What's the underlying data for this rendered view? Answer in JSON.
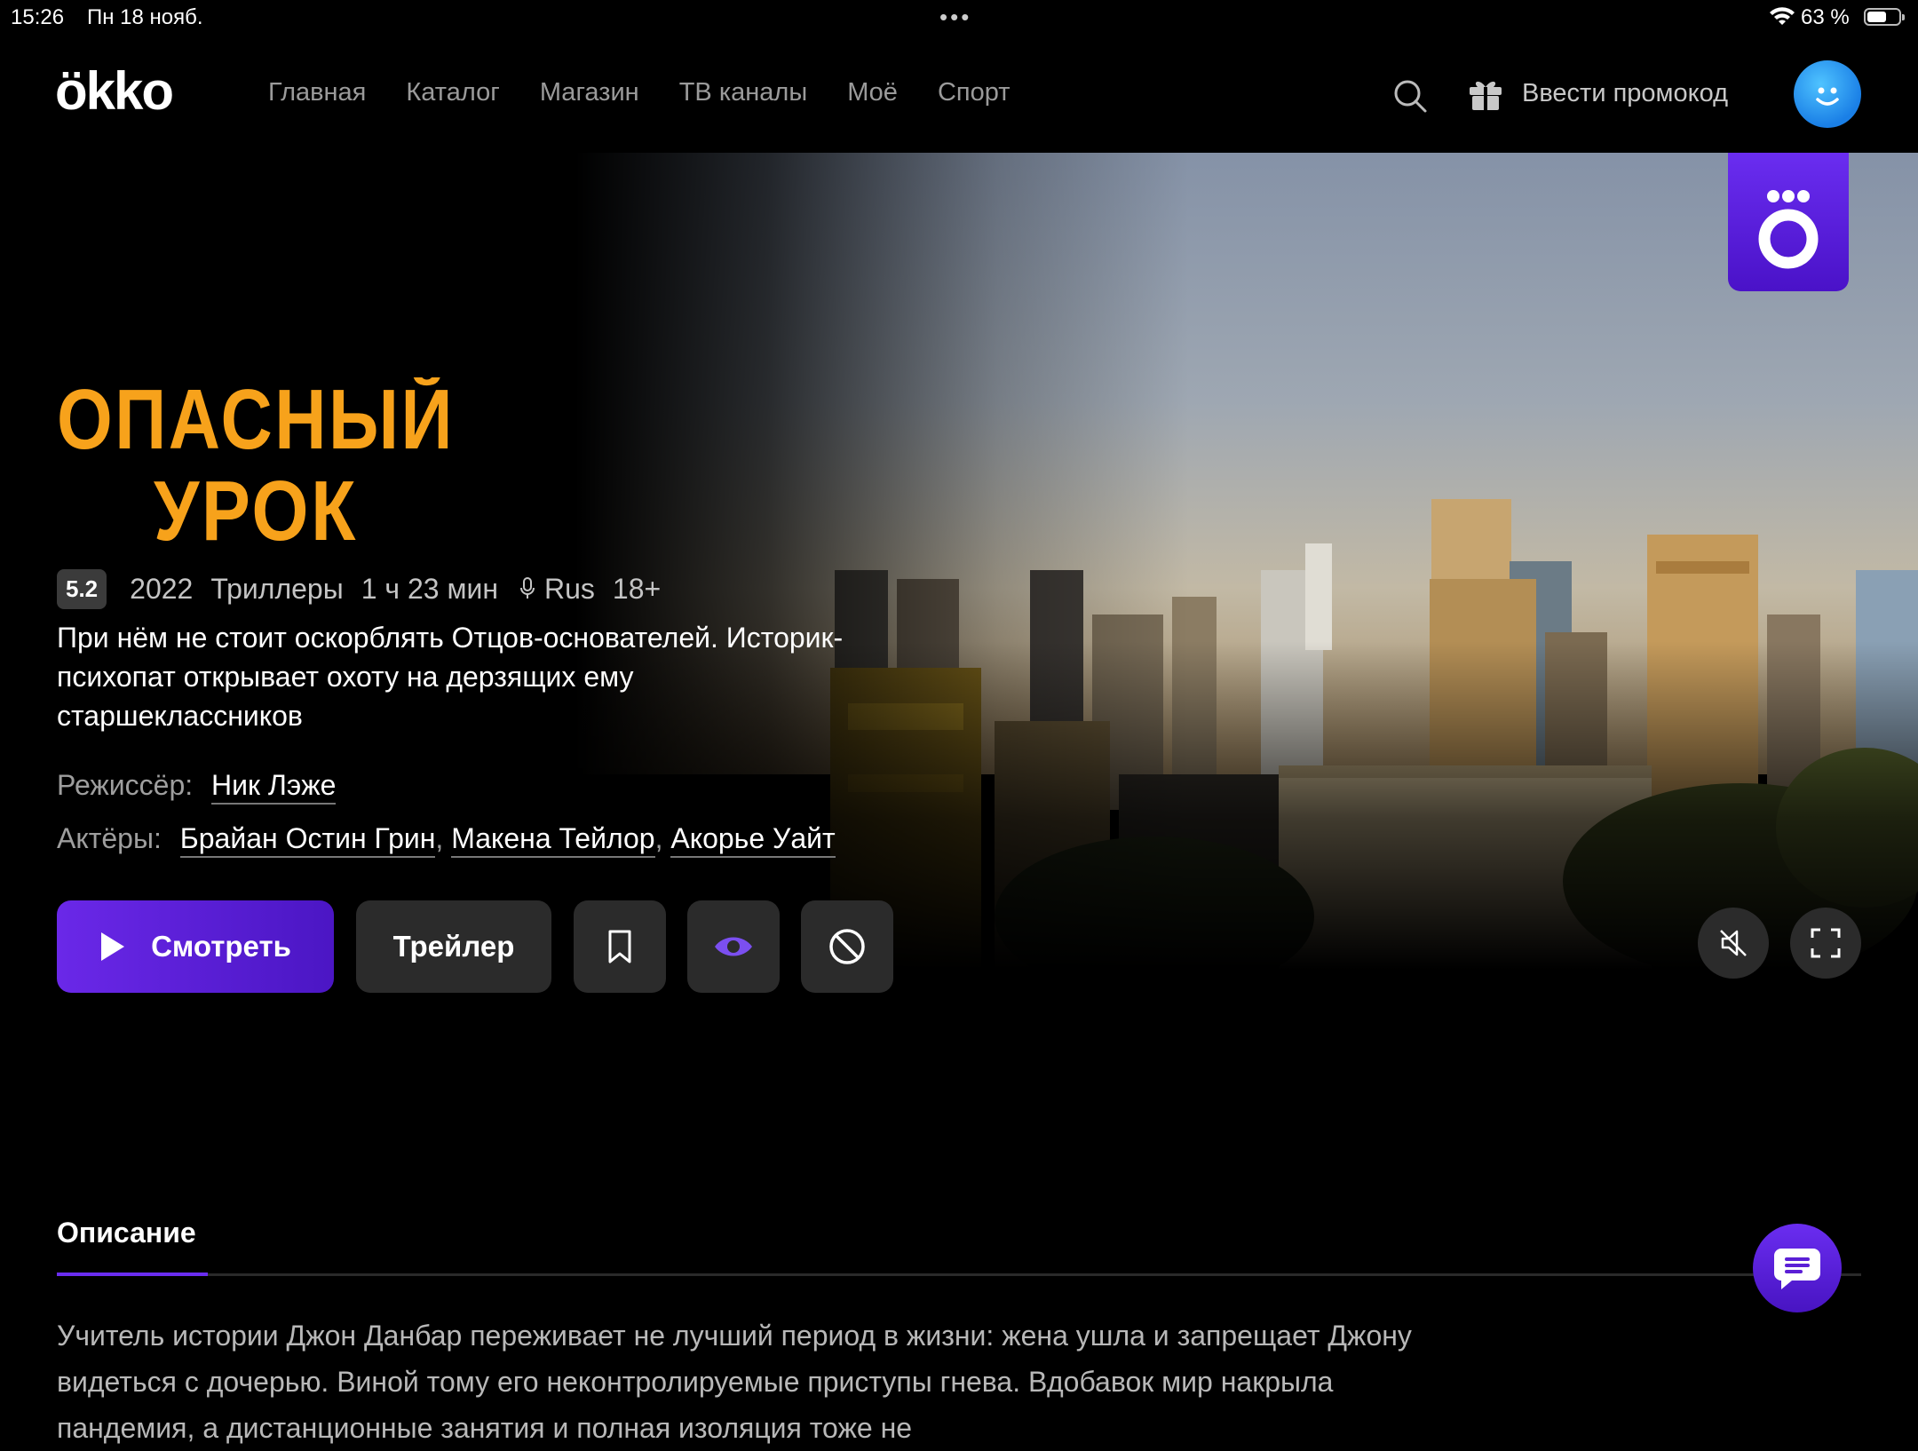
{
  "status_bar": {
    "time": "15:26",
    "date": "Пн 18 нояб.",
    "battery": "63 %",
    "battery_level": 0.63
  },
  "header": {
    "logo": "ökko",
    "nav": [
      "Главная",
      "Каталог",
      "Магазин",
      "ТВ каналы",
      "Моё",
      "Спорт"
    ],
    "promo_label": "Ввести промокод"
  },
  "movie": {
    "title_line1": "ОПАСНЫЙ",
    "title_line2": "УРОК",
    "rating": "5.2",
    "year": "2022",
    "genre": "Триллеры",
    "duration": "1 ч 23 мин",
    "audio": "Rus",
    "age": "18+",
    "tagline": "При нём не стоит оскорблять Отцов-основателей. Историк-психопат открывает охоту на дерзящих ему старшеклассников",
    "director_label": "Режиссёр:",
    "director": "Ник Лэже",
    "actors_label": "Актёры:",
    "actors": [
      "Брайан Остин Грин",
      "Макена Тейлор",
      "Акорье Уайт"
    ]
  },
  "actions": {
    "watch": "Смотреть",
    "trailer": "Трейлер"
  },
  "description": {
    "tab_label": "Описание",
    "text": "Учитель истории Джон Данбар переживает не лучший период в жизни: жена ушла и запрещает Джону видеться с дочерью. Виной тому его неконтролируемые приступы гнева. Вдобавок мир накрыла пандемия, а дистанционные занятия и полная изоляция тоже не"
  },
  "colors": {
    "accent": "#5b1fd6",
    "title_orange": "#f7a21b",
    "avatar": "#1a8fff"
  }
}
